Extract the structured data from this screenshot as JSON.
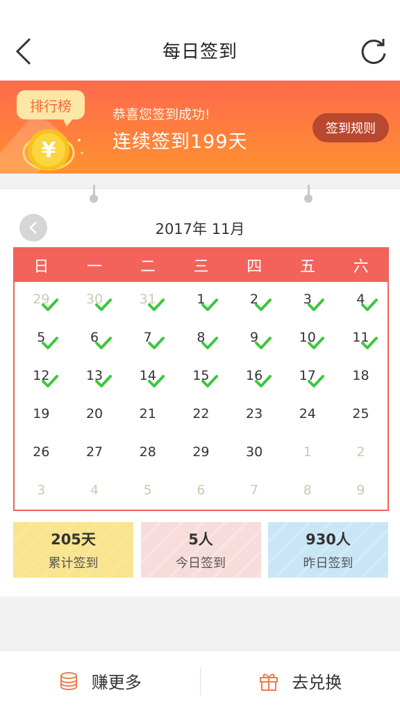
{
  "header": {
    "title": "每日签到",
    "back_icon": "back-arrow-icon",
    "refresh_icon": "refresh-icon"
  },
  "banner": {
    "rank_label": "排行榜",
    "coin_icon": "yen-coin-icon",
    "message": "恭喜您签到成功!",
    "streak": "连续签到199天",
    "rules_label": "签到规则",
    "colors": {
      "top": "#ff6a4e",
      "bottom": "#ff9132"
    }
  },
  "calendar": {
    "month_label": "2017年 11月",
    "prev_icon": "chevron-left-icon",
    "check_icon": "check-icon",
    "accent": "#f3625b",
    "weekdays": [
      "日",
      "一",
      "二",
      "三",
      "四",
      "五",
      "六"
    ],
    "days": [
      {
        "d": "29",
        "other": true,
        "checked": true
      },
      {
        "d": "30",
        "other": true,
        "checked": true
      },
      {
        "d": "31",
        "other": true,
        "checked": true
      },
      {
        "d": "1",
        "other": false,
        "checked": true
      },
      {
        "d": "2",
        "other": false,
        "checked": true
      },
      {
        "d": "3",
        "other": false,
        "checked": true
      },
      {
        "d": "4",
        "other": false,
        "checked": true
      },
      {
        "d": "5",
        "other": false,
        "checked": true
      },
      {
        "d": "6",
        "other": false,
        "checked": true
      },
      {
        "d": "7",
        "other": false,
        "checked": true
      },
      {
        "d": "8",
        "other": false,
        "checked": true
      },
      {
        "d": "9",
        "other": false,
        "checked": true
      },
      {
        "d": "10",
        "other": false,
        "checked": true
      },
      {
        "d": "11",
        "other": false,
        "checked": true
      },
      {
        "d": "12",
        "other": false,
        "checked": true
      },
      {
        "d": "13",
        "other": false,
        "checked": true
      },
      {
        "d": "14",
        "other": false,
        "checked": true
      },
      {
        "d": "15",
        "other": false,
        "checked": true
      },
      {
        "d": "16",
        "other": false,
        "checked": true
      },
      {
        "d": "17",
        "other": false,
        "checked": true
      },
      {
        "d": "18",
        "other": false,
        "checked": false
      },
      {
        "d": "19",
        "other": false,
        "checked": false
      },
      {
        "d": "20",
        "other": false,
        "checked": false
      },
      {
        "d": "21",
        "other": false,
        "checked": false
      },
      {
        "d": "22",
        "other": false,
        "checked": false
      },
      {
        "d": "23",
        "other": false,
        "checked": false
      },
      {
        "d": "24",
        "other": false,
        "checked": false
      },
      {
        "d": "25",
        "other": false,
        "checked": false
      },
      {
        "d": "26",
        "other": false,
        "checked": false
      },
      {
        "d": "27",
        "other": false,
        "checked": false
      },
      {
        "d": "28",
        "other": false,
        "checked": false
      },
      {
        "d": "29",
        "other": false,
        "checked": false
      },
      {
        "d": "30",
        "other": false,
        "checked": false
      },
      {
        "d": "1",
        "other": true,
        "checked": false
      },
      {
        "d": "2",
        "other": true,
        "checked": false
      },
      {
        "d": "3",
        "other": true,
        "checked": false
      },
      {
        "d": "4",
        "other": true,
        "checked": false
      },
      {
        "d": "5",
        "other": true,
        "checked": false
      },
      {
        "d": "6",
        "other": true,
        "checked": false
      },
      {
        "d": "7",
        "other": true,
        "checked": false
      },
      {
        "d": "8",
        "other": true,
        "checked": false
      },
      {
        "d": "9",
        "other": true,
        "checked": false
      }
    ]
  },
  "stats": [
    {
      "value": "205天",
      "label": "累计签到",
      "color": "#f9e490"
    },
    {
      "value": "5人",
      "label": "今日签到",
      "color": "#f7dcdc"
    },
    {
      "value": "930人",
      "label": "昨日签到",
      "color": "#c9e6f6"
    }
  ],
  "bottom": {
    "earn": {
      "label": "赚更多",
      "icon": "coin-stack-icon"
    },
    "exchange": {
      "label": "去兑换",
      "icon": "gift-icon"
    }
  }
}
